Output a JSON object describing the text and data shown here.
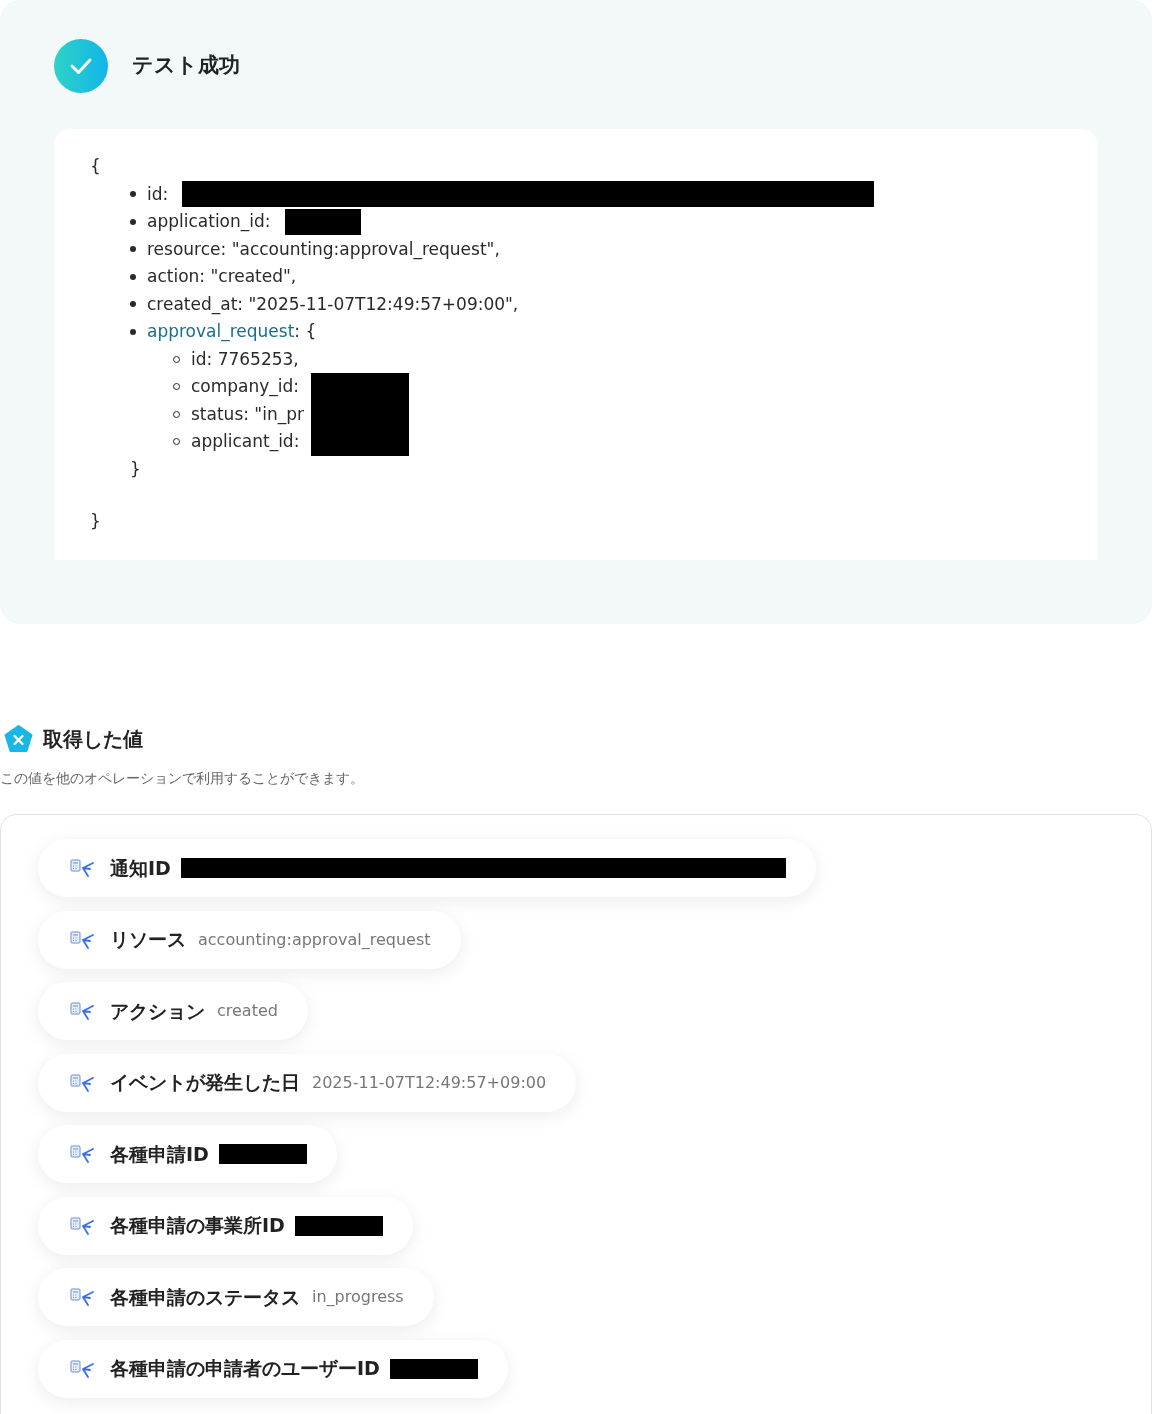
{
  "result": {
    "title": "テスト成功",
    "json_open": "{",
    "fields": [
      {
        "kind": "wide",
        "text": "id:"
      },
      {
        "kind": "narrow",
        "text": "application_id:"
      },
      {
        "kind": "plain",
        "text": "resource: \"accounting:approval_request\","
      },
      {
        "kind": "plain",
        "text": "action: \"created\","
      },
      {
        "kind": "plain",
        "text": "created_at: \"2025-11-07T12:49:57+09:00\","
      },
      {
        "kind": "object",
        "key": "approval_request",
        "text": ": {",
        "close": "}",
        "children": [
          {
            "text": "id: 7765253,",
            "redacted": false
          },
          {
            "text": "company_id:",
            "redacted": true
          },
          {
            "text": "status: \"in_pr",
            "redacted": true
          },
          {
            "text": "applicant_id:",
            "redacted": true
          }
        ]
      }
    ],
    "json_close": "}"
  },
  "values": {
    "title": "取得した値",
    "description": "この値を他のオペレーションで利用することができます。",
    "items": [
      {
        "label": "通知ID",
        "kind": "wide"
      },
      {
        "label": "リソース",
        "value": "accounting:approval_request"
      },
      {
        "label": "アクション",
        "value": "created"
      },
      {
        "label": "イベントが発生した日",
        "value": "2025-11-07T12:49:57+09:00"
      },
      {
        "label": "各種申請ID",
        "kind": "narrow"
      },
      {
        "label": "各種申請の事業所ID",
        "kind": "narrow"
      },
      {
        "label": "各種申請のステータス",
        "value": "in_progress"
      },
      {
        "label": "各種申請の申請者のユーザーID",
        "kind": "narrow"
      }
    ]
  }
}
